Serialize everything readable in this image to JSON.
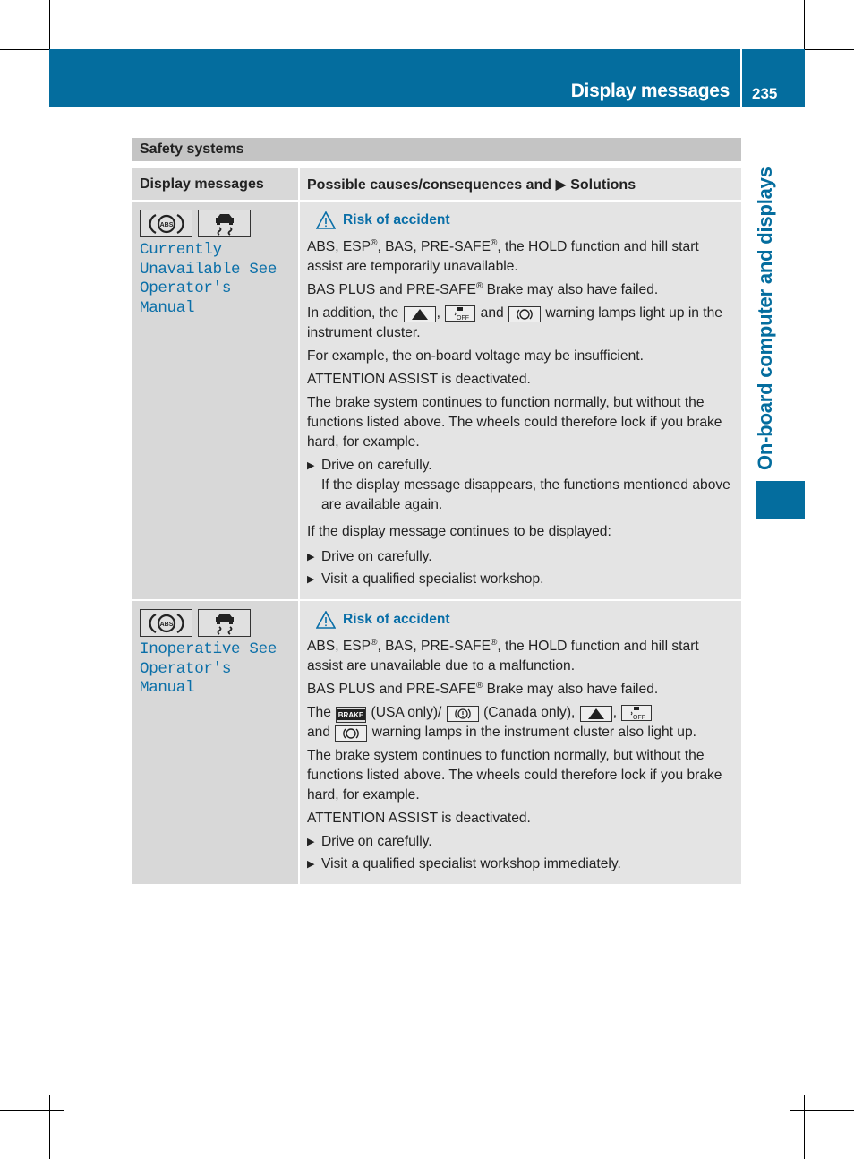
{
  "header": {
    "title": "Display messages",
    "page_number": "235"
  },
  "side_tab": {
    "label": "On-board computer and displays"
  },
  "section": {
    "title": "Safety systems"
  },
  "table": {
    "columns": [
      "Display messages",
      "Possible causes/consequences and ▶ Solutions"
    ],
    "rows": [
      {
        "icons": [
          "abs-warning-icon",
          "esp-skid-icon"
        ],
        "display_message": "Currently\nUnavailable See\nOperator's Manual",
        "warning_label": "Risk of accident",
        "paragraphs": {
          "p1_a": "ABS, ESP",
          "p1_b": ", BAS, PRE-SAFE",
          "p1_c": ", the HOLD function and hill start assist are temporarily unavailable.",
          "p2_a": "BAS PLUS and PRE-SAFE",
          "p2_b": " Brake may also have failed.",
          "p3_a": "In addition, the ",
          "p3_b": ", ",
          "p3_c": " and ",
          "p3_d": " warning lamps light up in the instrument cluster.",
          "p4": "For example, the on-board voltage may be insufficient.",
          "p5": "ATTENTION ASSIST is deactivated.",
          "p6": "The brake system continues to function normally, but without the functions listed above. The wheels could therefore lock if you brake hard, for example.",
          "b1": "Drive on carefully.",
          "b1_sub": "If the display message disappears, the functions mentioned above are available again.",
          "p7": "If the display message continues to be displayed:",
          "b2": "Drive on carefully.",
          "b3": "Visit a qualified specialist workshop."
        }
      },
      {
        "icons": [
          "abs-warning-icon",
          "esp-skid-icon"
        ],
        "display_message": "Inoperative See\nOperator's Manual",
        "warning_label": "Risk of accident",
        "paragraphs": {
          "p1_a": "ABS, ESP",
          "p1_b": ", BAS, PRE-SAFE",
          "p1_c": ", the HOLD function and hill start assist are unavailable due to a malfunction.",
          "p2_a": "BAS PLUS and PRE-SAFE",
          "p2_b": " Brake may also have failed.",
          "p3_a": "The ",
          "p3_b": " (USA only)/ ",
          "p3_c": " (Canada only), ",
          "p3_d": ", ",
          "p3_e": "and ",
          "p3_f": " warning lamps in the instrument cluster also light up.",
          "p4": "The brake system continues to function normally, but without the functions listed above. The wheels could therefore lock if you brake hard, for example.",
          "p5": "ATTENTION ASSIST is deactivated.",
          "b1": "Drive on carefully.",
          "b2": "Visit a qualified specialist workshop immediately."
        }
      }
    ]
  },
  "symbols": {
    "registered": "®",
    "brake_label": "BRAKE",
    "off_label": "OFF",
    "abs_label": "ABS"
  },
  "colors": {
    "brand_blue": "#046d9e",
    "link_blue": "#0a6fa8",
    "section_gray": "#c4c4c4",
    "cell_gray_left": "#d8d8d8",
    "cell_gray_right": "#e4e4e4"
  }
}
